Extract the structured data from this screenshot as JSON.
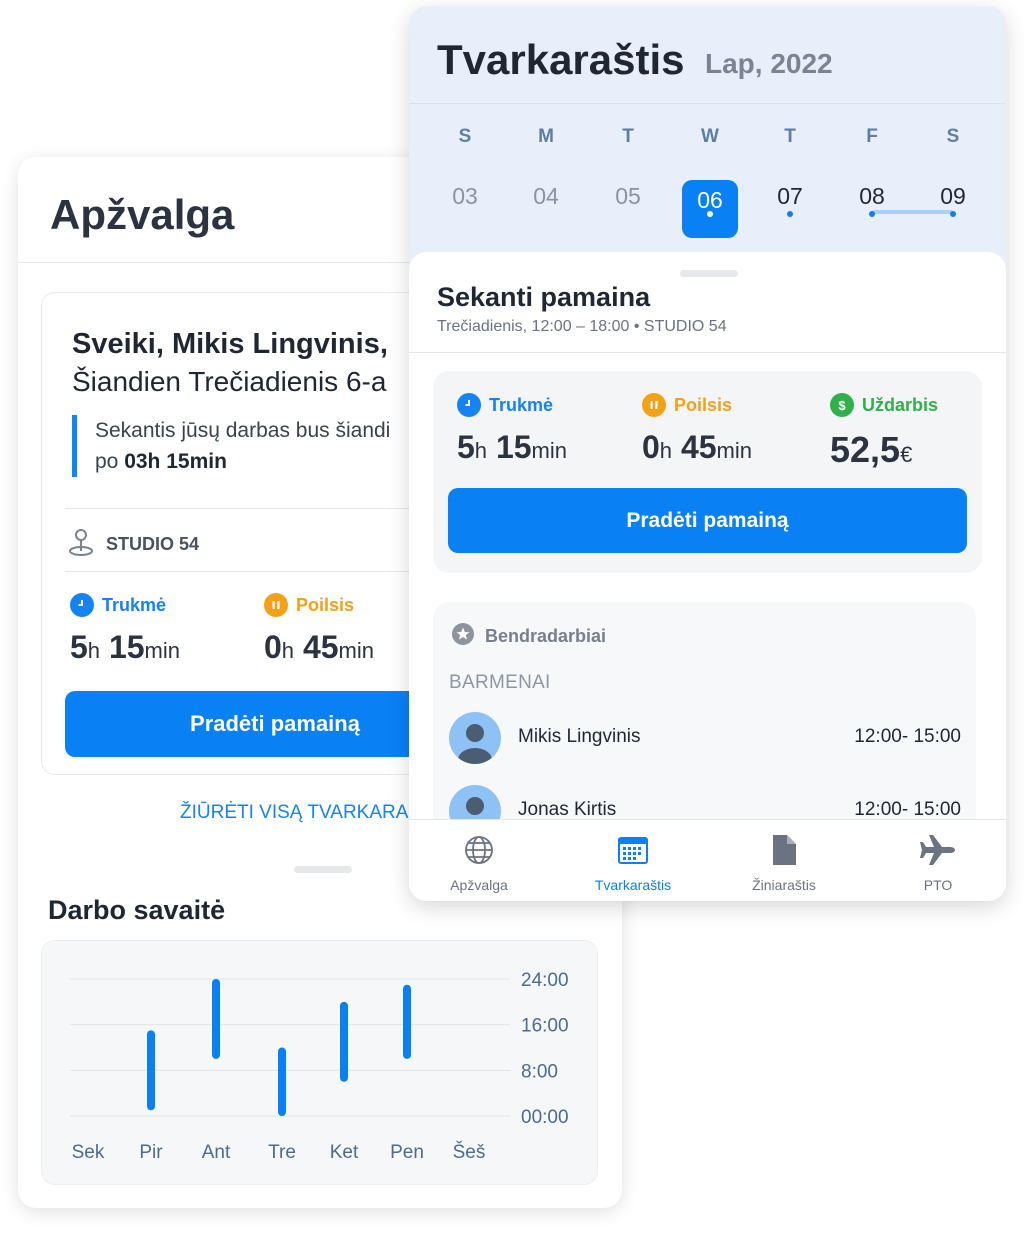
{
  "overview": {
    "title": "Apžvalga",
    "greeting_line1": "Sveiki, Mikis Lingvinis,",
    "greeting_line2": "Šiandien Trečiadienis 6-a",
    "next_note_text": "Sekantis jūsų darbas bus šiandi",
    "next_note_prefix": "po",
    "next_note_value": "03h 15min",
    "location": "STUDIO 54",
    "stats": {
      "duration_label": "Trukmė",
      "duration_h": "5",
      "duration_h_unit": "h",
      "duration_m": "15",
      "duration_m_unit": "min",
      "break_label": "Poilsis",
      "break_h": "0",
      "break_h_unit": "h",
      "break_m": "45",
      "break_m_unit": "min"
    },
    "start_button": "Pradėti pamainą",
    "schedule_link": "ŽIŪRĖTI VISĄ TVARKARAŠ",
    "week_title": "Darbo savaitė"
  },
  "chart_data": {
    "type": "bar",
    "title": "Darbo savaitė",
    "categories": [
      "Sek",
      "Pir",
      "Ant",
      "Tre",
      "Ket",
      "Pen",
      "Šeš"
    ],
    "y_ticks": [
      "24:00",
      "16:00",
      "8:00",
      "00:00"
    ],
    "ylim": [
      0,
      24
    ],
    "ranges": [
      null,
      [
        1,
        15
      ],
      [
        10,
        24
      ],
      [
        0,
        12
      ],
      [
        6,
        20
      ],
      [
        10,
        23
      ],
      null
    ],
    "color": "#0a80f5",
    "grid": true
  },
  "schedule": {
    "title": "Tvarkaraštis",
    "month": "Lap, 2022",
    "days": [
      {
        "letter": "S",
        "num": "03"
      },
      {
        "letter": "M",
        "num": "04"
      },
      {
        "letter": "T",
        "num": "05"
      },
      {
        "letter": "W",
        "num": "06"
      },
      {
        "letter": "T",
        "num": "07"
      },
      {
        "letter": "F",
        "num": "08"
      },
      {
        "letter": "S",
        "num": "09"
      }
    ],
    "selected_day": "06",
    "next_shift_title": "Sekanti pamaina",
    "next_shift_sub": "Trečiadienis, 12:00 – 18:00 • STUDIO 54",
    "stats": {
      "duration_label": "Trukmė",
      "duration_h": "5",
      "duration_h_unit": "h",
      "duration_m": "15",
      "duration_m_unit": "min",
      "break_label": "Poilsis",
      "break_h": "0",
      "break_h_unit": "h",
      "break_m": "45",
      "break_m_unit": "min",
      "earn_label": "Uždarbis",
      "earn_value": "52,5",
      "earn_unit": "€"
    },
    "start_button": "Pradėti pamainą",
    "coworkers_title": "Bendradarbiai",
    "group_label": "BARMENAI",
    "coworkers": [
      {
        "name": "Mikis Lingvinis",
        "time": "12:00- 15:00"
      },
      {
        "name": "Jonas Kirtis",
        "time": "12:00- 15:00"
      }
    ],
    "tabs": [
      {
        "label": "Apžvalga",
        "icon": "globe-icon"
      },
      {
        "label": "Tvarkaraštis",
        "icon": "calendar-icon"
      },
      {
        "label": "Žiniaraštis",
        "icon": "document-icon"
      },
      {
        "label": "PTO",
        "icon": "airplane-icon"
      }
    ],
    "active_tab": "Tvarkaraštis"
  },
  "colors": {
    "accent": "#0a80f5",
    "duration": "#1483f5",
    "break": "#f5a117",
    "earnings": "#2fb14a",
    "calendar_header": "#e9effa"
  }
}
